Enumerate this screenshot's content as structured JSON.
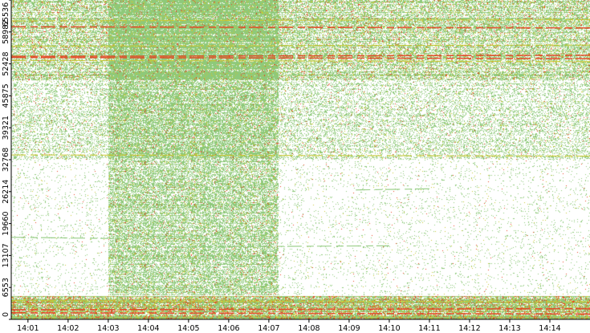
{
  "chart_data": {
    "type": "heatmap",
    "title": "",
    "xlabel": "",
    "ylabel": "",
    "x_ticks": [
      "14:01",
      "14:02",
      "14:03",
      "14:04",
      "14:05",
      "14:06",
      "14:07",
      "14:08",
      "14:09",
      "14:10",
      "14:11",
      "14:12",
      "14:13",
      "14:14"
    ],
    "x_range": [
      "14:00:35",
      "14:15:00"
    ],
    "y_ticks": [
      0,
      6553,
      13107,
      19660,
      26214,
      32768,
      39321,
      45875,
      52428,
      58982,
      65536
    ],
    "ylim": [
      0,
      65536
    ],
    "colors": {
      "low": "#8ec97a",
      "mid": "#c8c832",
      "high": "#e84020",
      "max": "#d02010",
      "background": "#ffffff"
    },
    "dense_regions": [
      {
        "name": "bottom-band",
        "x_start": "14:00:35",
        "x_end": "14:15:00",
        "y_start": 0,
        "y_end": 4800,
        "density": 0.95
      },
      {
        "name": "upper-band",
        "x_start": "14:00:35",
        "x_end": "14:15:00",
        "y_start": 49000,
        "y_end": 65536,
        "density": 0.55
      },
      {
        "name": "upper-green-block",
        "x_start": "14:03:00",
        "x_end": "14:07:15",
        "y_start": 49000,
        "y_end": 65536,
        "density": 0.75
      },
      {
        "name": "mid-band",
        "x_start": "14:00:35",
        "x_end": "14:15:00",
        "y_start": 32768,
        "y_end": 49000,
        "density": 0.28
      },
      {
        "name": "green-block",
        "x_start": "14:03:00",
        "x_end": "14:07:15",
        "y_start": 5000,
        "y_end": 49000,
        "density": 0.55
      },
      {
        "name": "sparse-area",
        "x_start": "14:00:35",
        "x_end": "14:15:00",
        "y_start": 5000,
        "y_end": 32768,
        "density": 0.05
      }
    ],
    "streaks": [
      {
        "y": 53500,
        "x_start": "14:00:35",
        "x_end": "14:15:00",
        "level": "high"
      },
      {
        "y": 54200,
        "x_start": "14:00:35",
        "x_end": "14:15:00",
        "level": "high"
      },
      {
        "y": 52900,
        "x_start": "14:00:35",
        "x_end": "14:15:00",
        "level": "mid"
      },
      {
        "y": 56300,
        "x_start": "14:00:35",
        "x_end": "14:15:00",
        "level": "mid"
      },
      {
        "y": 59800,
        "x_start": "14:00:35",
        "x_end": "14:15:00",
        "level": "high"
      },
      {
        "y": 61500,
        "x_start": "14:00:35",
        "x_end": "14:15:00",
        "level": "mid"
      },
      {
        "y": 33500,
        "x_start": "14:00:35",
        "x_end": "14:15:00",
        "level": "mid"
      },
      {
        "y": 15100,
        "x_start": "14:04:30",
        "x_end": "14:10:00",
        "level": "low"
      },
      {
        "y": 16600,
        "x_start": "14:00:35",
        "x_end": "14:03:00",
        "level": "low"
      },
      {
        "y": 26800,
        "x_start": "14:09:10",
        "x_end": "14:11:00",
        "level": "low"
      },
      {
        "y": 3600,
        "x_start": "14:00:35",
        "x_end": "14:15:00",
        "level": "mid"
      },
      {
        "y": 2200,
        "x_start": "14:00:35",
        "x_end": "14:15:00",
        "level": "high"
      },
      {
        "y": 1100,
        "x_start": "14:00:35",
        "x_end": "14:15:00",
        "level": "high"
      }
    ]
  }
}
